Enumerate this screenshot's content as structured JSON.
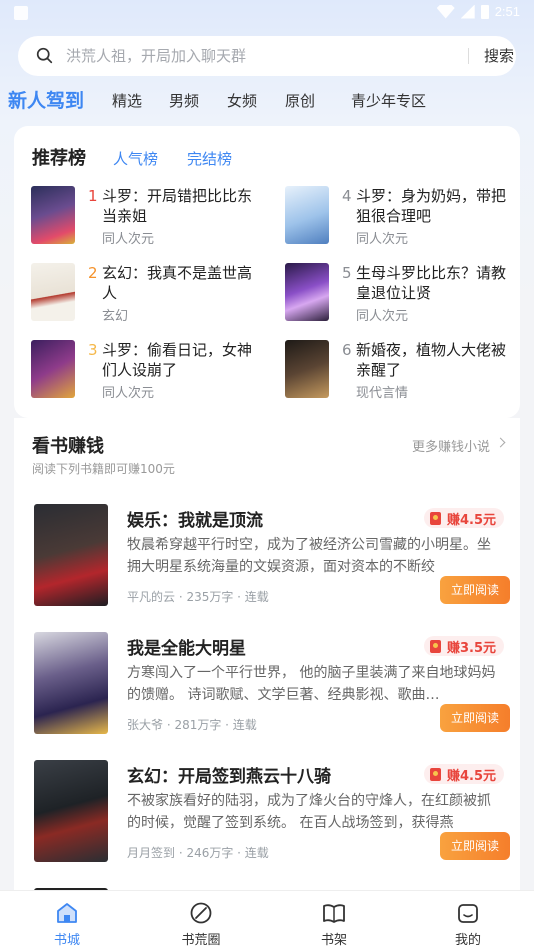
{
  "status_bar": {
    "time": "2:51"
  },
  "search": {
    "placeholder": "洪荒人祖，开局加入聊天群",
    "button_label": "搜索"
  },
  "channel_tabs": [
    "新人驾到",
    "精选",
    "男频",
    "女频",
    "原创",
    "青少年专区"
  ],
  "ranking": {
    "tabs": [
      "推荐榜",
      "人气榜",
      "完结榜"
    ],
    "items": [
      {
        "rank": "1",
        "title": "斗罗：开局错把比比东当亲姐",
        "category": "同人次元",
        "rank_color": "#e8453c"
      },
      {
        "rank": "2",
        "title": "玄幻：我真不是盖世高人",
        "category": "玄幻",
        "rank_color": "#f5922b"
      },
      {
        "rank": "3",
        "title": "斗罗：偷看日记，女神们人设崩了",
        "category": "同人次元",
        "rank_color": "#f5b84a"
      },
      {
        "rank": "4",
        "title": "斗罗：身为奶妈，带把狙很合理吧",
        "category": "同人次元",
        "rank_color": "#8a8d93"
      },
      {
        "rank": "5",
        "title": "生母斗罗比比东？请教皇退位让贤",
        "category": "同人次元",
        "rank_color": "#8a8d93"
      },
      {
        "rank": "6",
        "title": "新婚夜，植物人大佬被亲醒了",
        "category": "现代言情",
        "rank_color": "#8a8d93"
      }
    ]
  },
  "earn": {
    "title": "看书赚钱",
    "subtitle": "阅读下列书籍即可赚100元",
    "more_label": "更多赚钱小说",
    "books": [
      {
        "title": "娱乐：我就是顶流",
        "desc": "牧晨希穿越平行时空，成为了被经济公司雪藏的小明星。坐拥大明星系统海量的文娱资源，面对资本的不断绞",
        "meta": "平凡的云 · 235万字 · 连载",
        "reward": "赚4.5元",
        "button": "立即阅读"
      },
      {
        "title": "我是全能大明星",
        "desc": "方寒闯入了一个平行世界， 他的脑子里装满了来自地球妈妈的馈赠。 诗词歌赋、文学巨著、经典影视、歌曲…",
        "meta": "张大爷 · 281万字 · 连载",
        "reward": "赚3.5元",
        "button": "立即阅读"
      },
      {
        "title": "玄幻：开局签到燕云十八骑",
        "desc": "不被家族看好的陆羽，成为了烽火台的守烽人，在红颜被抓的时候，觉醒了签到系统。 在百人战场签到，获得燕",
        "meta": "月月签到 · 246万字 · 连载",
        "reward": "赚4.5元",
        "button": "立即阅读"
      }
    ]
  },
  "bottom_nav": [
    "书城",
    "书荒圈",
    "书架",
    "我的"
  ],
  "colors": {
    "accent": "#3e87f2",
    "reward_red": "#e8453c",
    "button_orange": "#f57e2b"
  }
}
